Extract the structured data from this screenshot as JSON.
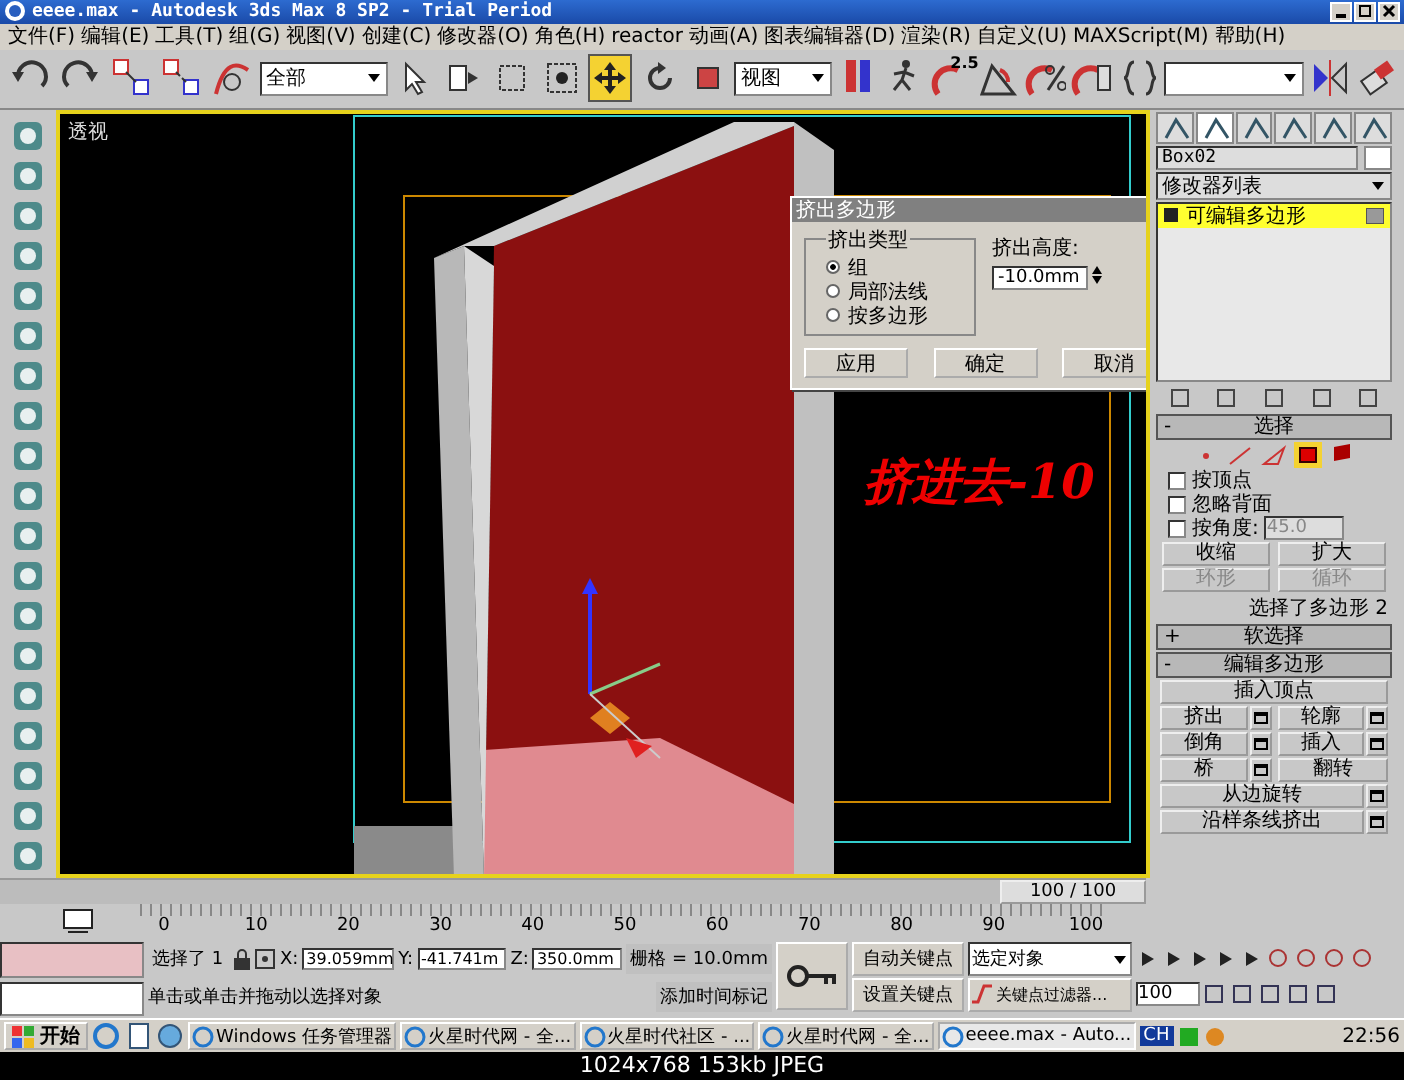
{
  "window": {
    "title": "eeee.max - Autodesk 3ds Max 8 SP2  - Trial Period"
  },
  "menu": [
    "文件(F)",
    "编辑(E)",
    "工具(T)",
    "组(G)",
    "视图(V)",
    "创建(C)",
    "修改器(O)",
    "角色(H)",
    "reactor",
    "动画(A)",
    "图表编辑器(D)",
    "渲染(R)",
    "自定义(U)",
    "MAXScript(M)",
    "帮助(H)"
  ],
  "toolbar": {
    "selection_filter": "全部",
    "coord_system": "视图",
    "snap_label": "2.5",
    "tools": [
      {
        "selected": false
      },
      {
        "selected": false
      },
      {
        "selected": false
      },
      {
        "selected": false
      },
      {
        "selected": true
      },
      {
        "selected": false
      },
      {
        "selected": false
      }
    ]
  },
  "viewport": {
    "label": "透视",
    "annotation": "挤进去-10"
  },
  "dialog": {
    "title": "挤出多边形",
    "group_label": "挤出类型",
    "options": [
      {
        "label": "组",
        "selected": true
      },
      {
        "label": "局部法线",
        "selected": false
      },
      {
        "label": "按多边形",
        "selected": false
      }
    ],
    "height_label": "挤出高度:",
    "height_value": "-10.0mm",
    "buttons": [
      "应用",
      "确定",
      "取消"
    ]
  },
  "command_panel": {
    "object_name": "Box02",
    "modifier_list": "修改器列表",
    "stack": [
      {
        "label": "可编辑多边形",
        "selected": true
      }
    ],
    "selection": {
      "title": "选择",
      "sign": "-",
      "levels": [
        {
          "selected": false
        },
        {
          "selected": false
        },
        {
          "selected": false
        },
        {
          "selected": true
        },
        {
          "selected": false
        }
      ],
      "checks": [
        {
          "label": "按顶点",
          "checked": false
        },
        {
          "label": "忽略背面",
          "checked": false
        },
        {
          "label": "按角度:",
          "checked": false,
          "value": "45.0"
        }
      ],
      "buttons": [
        {
          "label": "收缩",
          "disabled": false
        },
        {
          "label": "扩大",
          "disabled": false
        },
        {
          "label": "环形",
          "disabled": true
        },
        {
          "label": "循环",
          "disabled": true
        }
      ],
      "info": "选择了多边形 2"
    },
    "rollouts": [
      {
        "sign": "+",
        "title": "软选择"
      },
      {
        "sign": "-",
        "title": "编辑多边形"
      }
    ],
    "edit_buttons": [
      {
        "label": "插入顶点",
        "settings": false,
        "wide": true
      },
      {
        "label": "挤出",
        "settings": true,
        "wide": false
      },
      {
        "label": "轮廓",
        "settings": true,
        "wide": false
      },
      {
        "label": "倒角",
        "settings": true,
        "wide": false
      },
      {
        "label": "插入",
        "settings": true,
        "wide": false
      },
      {
        "label": "桥",
        "settings": true,
        "wide": false
      },
      {
        "label": "翻转",
        "settings": false,
        "wide": false
      },
      {
        "label": "从边旋转",
        "settings": true,
        "wide": true
      },
      {
        "label": "沿样条线挤出",
        "settings": true,
        "wide": true
      }
    ]
  },
  "timeline": {
    "slider": "100 / 100",
    "level": 1,
    "ticks": [
      "0",
      "10",
      "20",
      "30",
      "40",
      "50",
      "60",
      "70",
      "80",
      "90",
      "100"
    ]
  },
  "status": {
    "selected": "选择了 1",
    "x_label": "X:",
    "x": "39.059mm",
    "y_label": "Y:",
    "y": "-41.741m",
    "z_label": "Z:",
    "z": "350.0mm",
    "grid": "栅格 = 10.0mm",
    "prompt": "单击或单击并拖动以选择对象",
    "time_tag": "添加时间标记",
    "auto_key": "自动关键点",
    "set_key": "设置关键点",
    "key_mode": "选定对象",
    "key_filters": "关键点过滤器...",
    "frame": "100"
  },
  "taskbar": {
    "start": "开始",
    "tasks": [
      "Windows 任务管理器",
      "火星时代网 - 全...",
      "火星时代社区 - ...",
      "火星时代网 - 全...",
      "eeee.max - Auto..."
    ],
    "lang": "CH",
    "clock": "22:56"
  },
  "caption": "1024x768 153kb JPEG"
}
